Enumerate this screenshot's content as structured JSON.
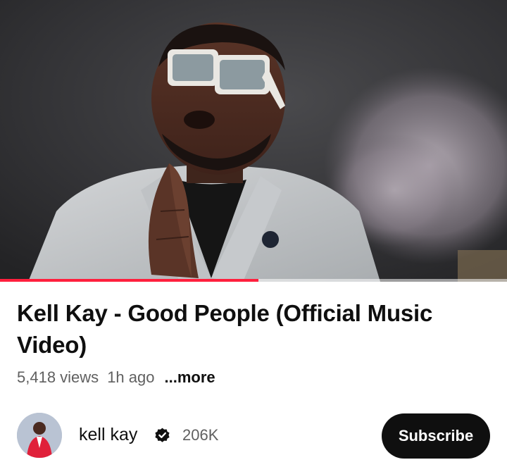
{
  "video": {
    "progress_fraction": 0.51,
    "accent_color": "#ff1f3d"
  },
  "title": "Kell Kay - Good People (Official Music Video)",
  "meta": {
    "views": "5,418 views",
    "age": "1h ago",
    "more": "...more"
  },
  "channel": {
    "name": "kell kay",
    "verified_icon": "verified-badge-icon",
    "subscribers": "206K",
    "subscribe_label": "Subscribe"
  }
}
